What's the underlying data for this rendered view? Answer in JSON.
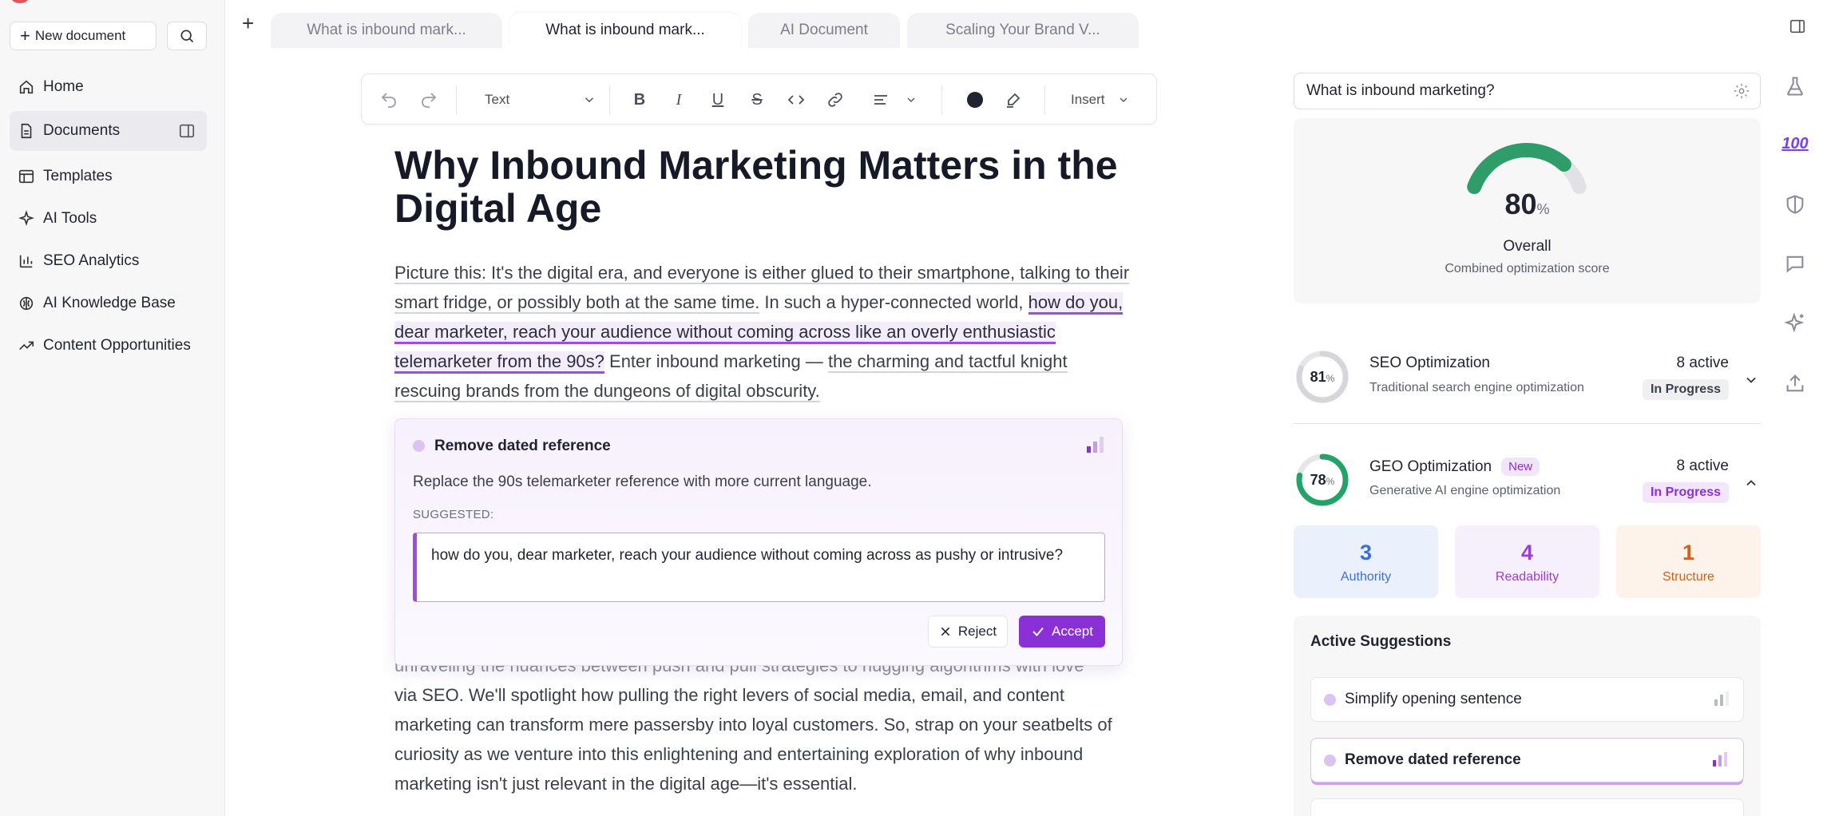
{
  "sidebar": {
    "new_document": "New document",
    "items": [
      {
        "label": "Home"
      },
      {
        "label": "Documents"
      },
      {
        "label": "Templates"
      },
      {
        "label": "AI Tools"
      },
      {
        "label": "SEO Analytics"
      },
      {
        "label": "AI Knowledge Base"
      },
      {
        "label": "Content Opportunities"
      }
    ]
  },
  "tabs": [
    {
      "label": "What is inbound mark..."
    },
    {
      "label": "What is inbound mark..."
    },
    {
      "label": "AI Document"
    },
    {
      "label": "Scaling Your Brand V..."
    }
  ],
  "toolbar": {
    "block_type": "Text",
    "insert": "Insert"
  },
  "document": {
    "title": "Why Inbound Marketing Matters in the Digital Age",
    "p1_a": "Picture this: It's the digital era, and everyone is either glued to their smartphone, talking to their smart fridge, or possibly both at the same time.",
    "p1_b": " In such a hyper-connected world, ",
    "p1_c": "how do you, dear marketer, reach your audience without coming across like an overly enthusiastic telemarketer from the 90s?",
    "p1_d": " Enter inbound marketing — ",
    "p1_e": "the charming and tactful knight rescuing brands from the dungeons of digital obscurity.",
    "p2_partial": "unraveling the nuances between push and pull strategies to hugging algorithms with love",
    "p2": "via SEO. We'll spotlight how pulling the right levers of social media, email, and content marketing can transform mere passersby into loyal customers. So, strap on your seatbelts of curiosity as we venture into this enlightening and entertaining exploration of why inbound marketing isn't just relevant in the digital age—it's essential."
  },
  "suggestion_popup": {
    "title": "Remove dated reference",
    "description": "Replace the 90s telemarketer reference with more current language.",
    "suggested_label": "SUGGESTED:",
    "suggested_text": "how do you, dear marketer, reach your audience without coming across as pushy or intrusive?",
    "reject": "Reject",
    "accept": "Accept"
  },
  "right_panel": {
    "keyword": "What is inbound marketing?",
    "score": {
      "value": "80",
      "unit": "%",
      "fraction": 0.8,
      "label": "Overall",
      "sublabel": "Combined optimization score"
    },
    "seo": {
      "score": "81",
      "unit": "%",
      "fraction": 0.81,
      "name": "SEO Optimization",
      "description": "Traditional search engine optimization",
      "active": "8 active",
      "status": "In Progress"
    },
    "geo": {
      "score": "78",
      "unit": "%",
      "fraction": 0.78,
      "name": "GEO Optimization",
      "badge": "New",
      "description": "Generative AI engine optimization",
      "active": "8 active",
      "status": "In Progress"
    },
    "metrics": [
      {
        "value": "3",
        "label": "Authority",
        "color": "#3b6fd8",
        "bg": "#eaf1fd"
      },
      {
        "value": "4",
        "label": "Readability",
        "color": "#9a3fd0",
        "bg": "#f6effc"
      },
      {
        "value": "1",
        "label": "Structure",
        "color": "#d2601a",
        "bg": "#fdf3ea"
      }
    ],
    "active_suggestions": {
      "heading": "Active Suggestions",
      "items": [
        {
          "label": "Simplify opening sentence"
        },
        {
          "label": "Remove dated reference"
        }
      ]
    }
  },
  "colors": {
    "accent": "#8b2fd6",
    "gauge": "#2e9d6a",
    "seo_ring": "#d6d6da",
    "geo_ring": "#23a26a"
  }
}
